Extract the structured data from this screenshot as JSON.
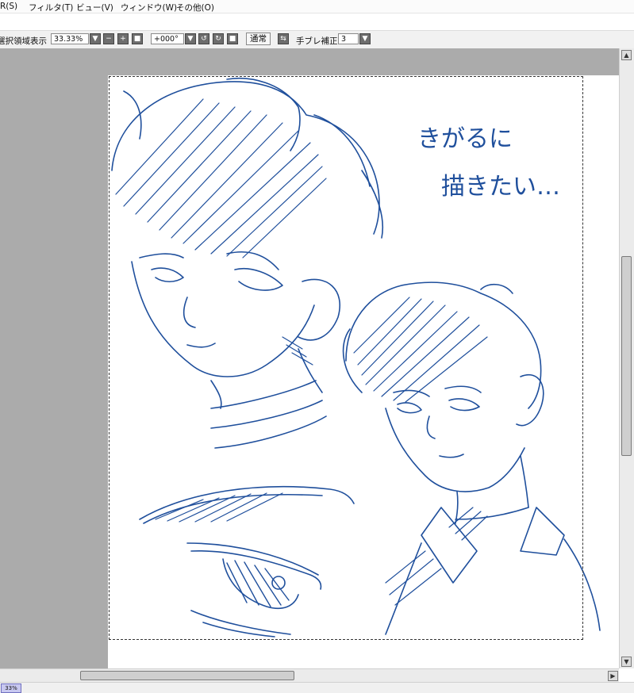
{
  "menubar": {
    "items": [
      "R(S)",
      "フィルタ(T)",
      "ビュー(V)",
      "ウィンドウ(W)",
      "その他(O)"
    ]
  },
  "toolbar": {
    "selection_label": "選択領域表示",
    "zoom_value": "33.33%",
    "rotation_value": "+000°",
    "blend_mode": "通常",
    "stabilizer_label": "手ブレ補正",
    "stabilizer_value": "3"
  },
  "canvas": {
    "handwritten_line1": "きがるに",
    "handwritten_line2": "描きたい…"
  },
  "status": {
    "zoom": "33%"
  },
  "colors": {
    "ink": "#1f4f9c",
    "canvas_bg": "#ababab",
    "paper": "#ffffff"
  }
}
